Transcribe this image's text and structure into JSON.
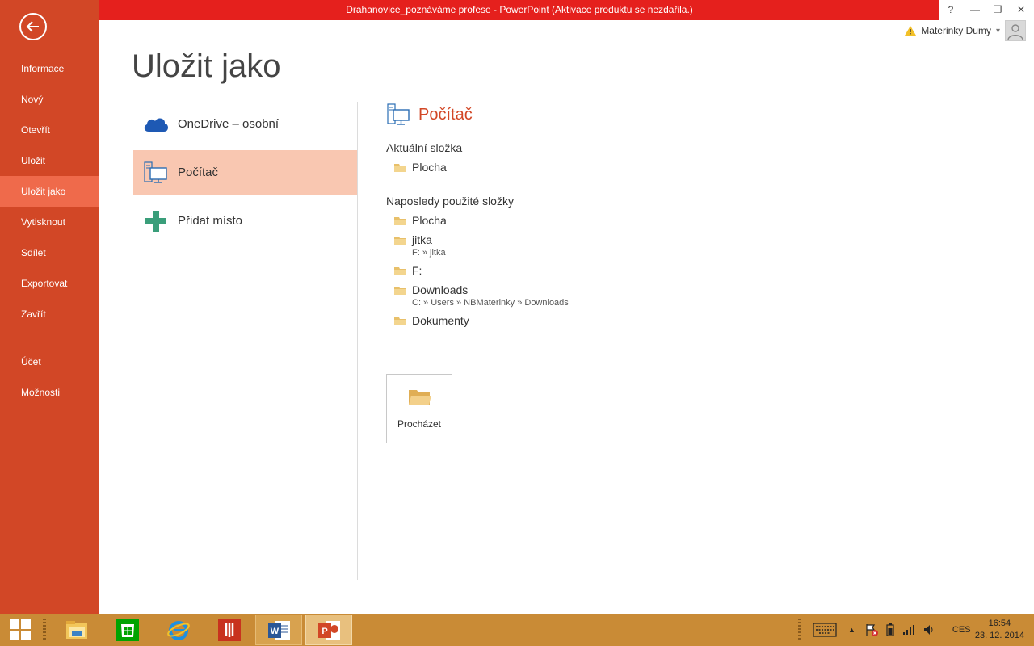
{
  "window": {
    "title": "Drahanovice_poznáváme profese -  PowerPoint (Aktivace produktu se nezdařila.)",
    "help": "?",
    "minimize": "—",
    "restore": "❐",
    "close": "✕"
  },
  "account": {
    "user": "Materinky Dumy",
    "dropdown": "▾"
  },
  "backstage": {
    "items": [
      {
        "label": "Informace"
      },
      {
        "label": "Nový"
      },
      {
        "label": "Otevřít"
      },
      {
        "label": "Uložit"
      },
      {
        "label": "Uložit jako",
        "active": true
      },
      {
        "label": "Vytisknout"
      },
      {
        "label": "Sdílet"
      },
      {
        "label": "Exportovat"
      },
      {
        "label": "Zavřít"
      }
    ],
    "bottom_items": [
      {
        "label": "Účet"
      },
      {
        "label": "Možnosti"
      }
    ]
  },
  "page": {
    "title": "Uložit jako"
  },
  "places": [
    {
      "label": "OneDrive – osobní",
      "icon": "cloud-icon"
    },
    {
      "label": "Počítač",
      "icon": "computer-icon",
      "active": true
    },
    {
      "label": "Přidat místo",
      "icon": "plus-icon"
    }
  ],
  "detail": {
    "title": "Počítač",
    "current_label": "Aktuální složka",
    "current_folder": {
      "name": "Plocha"
    },
    "recent_label": "Naposledy použité složky",
    "recent": [
      {
        "name": "Plocha",
        "path": ""
      },
      {
        "name": "jitka",
        "path": "F: » jitka"
      },
      {
        "name": "F:",
        "path": ""
      },
      {
        "name": "Downloads",
        "path": "C: » Users » NBMaterinky » Downloads"
      },
      {
        "name": "Dokumenty",
        "path": ""
      }
    ],
    "browse_label": "Procházet"
  },
  "taskbar": {
    "apps": [
      "file-explorer-icon",
      "store-icon",
      "internet-explorer-icon",
      "acrobat-icon",
      "word-icon",
      "powerpoint-icon"
    ],
    "language": "CES",
    "time": "16:54",
    "date": "23. 12. 2014"
  },
  "colors": {
    "accent": "#d24726",
    "title_bar": "#e5201d",
    "selected_place": "#f9c7b1",
    "taskbar": "#c98b36"
  }
}
